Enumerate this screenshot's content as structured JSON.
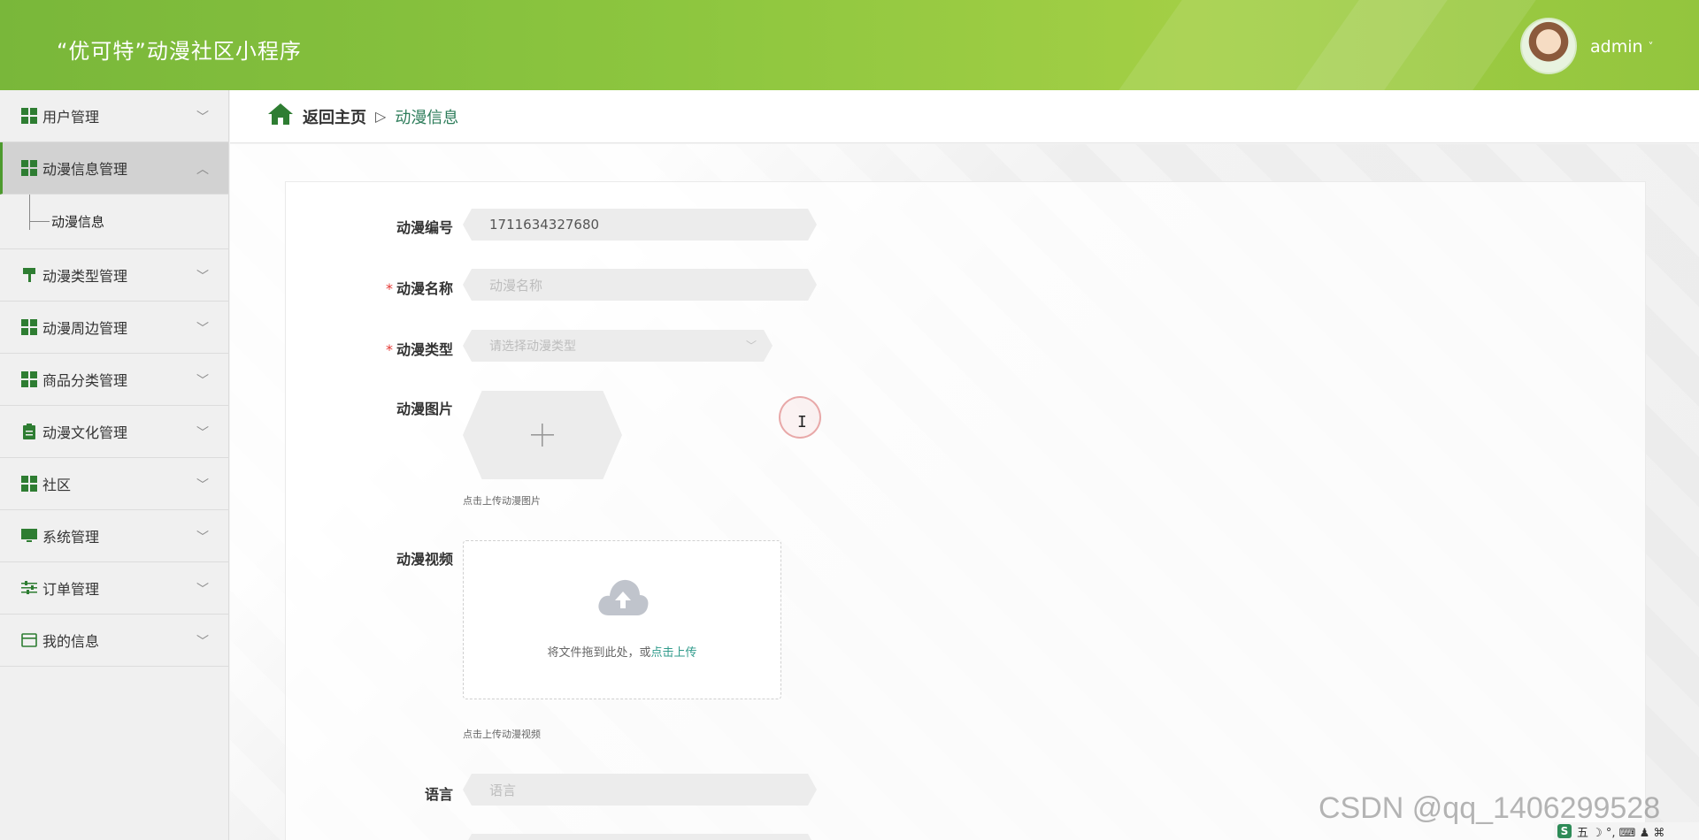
{
  "header": {
    "title": "“优可特”动漫社区小程序",
    "username": "admin",
    "user_chevron": "˅"
  },
  "sidebar": {
    "items": [
      {
        "label": "用户管理",
        "icon": "grid-icon"
      },
      {
        "label": "动漫信息管理",
        "icon": "grid-icon",
        "expanded": true,
        "children": [
          {
            "label": "动漫信息"
          }
        ]
      },
      {
        "label": "动漫类型管理",
        "icon": "paint-roller-icon"
      },
      {
        "label": "动漫周边管理",
        "icon": "grid-icon"
      },
      {
        "label": "商品分类管理",
        "icon": "grid-icon"
      },
      {
        "label": "动漫文化管理",
        "icon": "clipboard-icon"
      },
      {
        "label": "社区",
        "icon": "grid-icon"
      },
      {
        "label": "系统管理",
        "icon": "monitor-icon"
      },
      {
        "label": "订单管理",
        "icon": "sliders-icon"
      },
      {
        "label": "我的信息",
        "icon": "card-icon"
      }
    ]
  },
  "breadcrumb": {
    "home": "返回主页",
    "separator": "▷",
    "current": "动漫信息"
  },
  "form": {
    "id_label": "动漫编号",
    "id_value": "1711634327680",
    "name_label": "动漫名称",
    "name_placeholder": "动漫名称",
    "type_label": "动漫类型",
    "type_placeholder": "请选择动漫类型",
    "image_label": "动漫图片",
    "image_hint": "点击上传动漫图片",
    "video_label": "动漫视频",
    "video_drop_text": "将文件拖到此处，或",
    "video_drop_link": "点击上传",
    "video_hint": "点击上传动漫视频",
    "language_label": "语言",
    "language_placeholder": "语言",
    "required_mark": "*"
  },
  "overlay": {
    "watermark": "CSDN @qq_1406299528",
    "tray_text": "五 ☽ °, ⌨ ♟ ⌘"
  },
  "colors": {
    "header_green": "#8dc63f",
    "brand_dark_green": "#2e7d32",
    "link_teal": "#2e9a8a",
    "required_red": "#e53935"
  }
}
